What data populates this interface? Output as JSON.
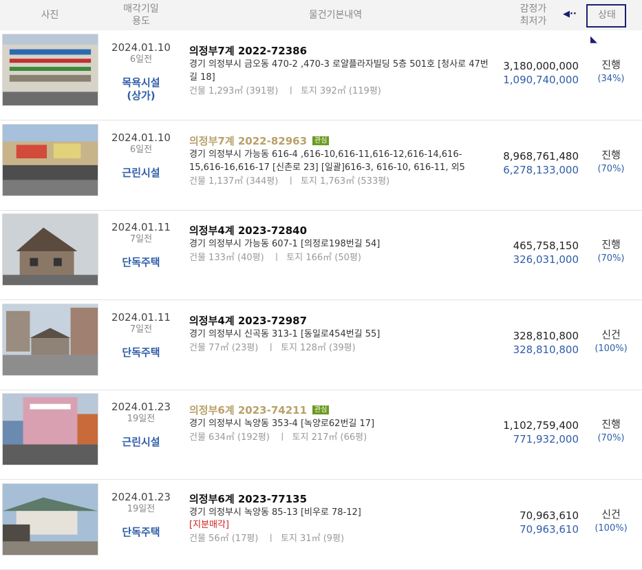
{
  "header": {
    "photo": "사진",
    "date_line1": "매각기일",
    "date_line2": "용도",
    "info": "물건기본내역",
    "price_line1": "감정가",
    "price_line2": "최저가",
    "status": "상태"
  },
  "colors": {
    "accent_blue": "#2e5da8",
    "favorite_gold": "#b9a06a",
    "tag_green": "#6a9a1f",
    "annotation_navy": "#1a1f6e"
  },
  "rows": [
    {
      "date": "2024.01.10",
      "ago": "6일전",
      "use": "목욕시설\n(상가)",
      "case": "의정부7계 2022-72386",
      "fav": false,
      "tag": "",
      "addr": "경기 의정부시 금오동 470-2 ,470-3 로얄플라자빌딩 5층 501호 [청사로 47번길 18]",
      "note": "",
      "area": "건물 1,293㎡ (391평)   ㅣ  토지 392㎡ (119평)",
      "appraisal": "3,180,000,000",
      "minimum": "1,090,740,000",
      "status": "진행",
      "pct": "(34%)"
    },
    {
      "date": "2024.01.10",
      "ago": "6일전",
      "use": "근린시설",
      "case": "의정부7계 2022-82963",
      "fav": true,
      "tag": "관심",
      "addr": "경기 의정부시 가능동 616-4 ,616-10,616-11,616-12,616-14,616-15,616-16,616-17 [신촌로 23]  [일괄]616-3, 616-10, 616-11, 외5",
      "note": "",
      "area": "건물 1,137㎡ (344평)   ㅣ  토지 1,763㎡ (533평)",
      "appraisal": "8,968,761,480",
      "minimum": "6,278,133,000",
      "status": "진행",
      "pct": "(70%)"
    },
    {
      "date": "2024.01.11",
      "ago": "7일전",
      "use": "단독주택",
      "case": "의정부4계 2023-72840",
      "fav": false,
      "tag": "",
      "addr": "경기 의정부시 가능동 607-1 [의정로198번길 54]",
      "note": "",
      "area": "건물 133㎡ (40평)   ㅣ  토지 166㎡ (50평)",
      "appraisal": "465,758,150",
      "minimum": "326,031,000",
      "status": "진행",
      "pct": "(70%)"
    },
    {
      "date": "2024.01.11",
      "ago": "7일전",
      "use": "단독주택",
      "case": "의정부4계 2023-72987",
      "fav": false,
      "tag": "",
      "addr": "경기 의정부시 신곡동 313-1 [동일로454번길 55]",
      "note": "",
      "area": "건물 77㎡ (23평)   ㅣ  토지 128㎡ (39평)",
      "appraisal": "328,810,800",
      "minimum": "328,810,800",
      "status": "신건",
      "pct": "(100%)"
    },
    {
      "date": "2024.01.23",
      "ago": "19일전",
      "use": "근린시설",
      "case": "의정부6계 2023-74211",
      "fav": true,
      "tag": "관심",
      "addr": "경기 의정부시 녹양동 353-4 [녹양로62번길 17]",
      "note": "",
      "area": "건물 634㎡ (192평)   ㅣ  토지 217㎡ (66평)",
      "appraisal": "1,102,759,400",
      "minimum": "771,932,000",
      "status": "진행",
      "pct": "(70%)"
    },
    {
      "date": "2024.01.23",
      "ago": "19일전",
      "use": "단독주택",
      "case": "의정부6계 2023-77135",
      "fav": false,
      "tag": "",
      "addr": "경기 의정부시 녹양동 85-13 [비우로 78-12]",
      "note": "[지분매각]",
      "area": "건물 56㎡ (17평)   ㅣ  토지 31㎡ (9평)",
      "appraisal": "70,963,610",
      "minimum": "70,963,610",
      "status": "신건",
      "pct": "(100%)"
    }
  ]
}
